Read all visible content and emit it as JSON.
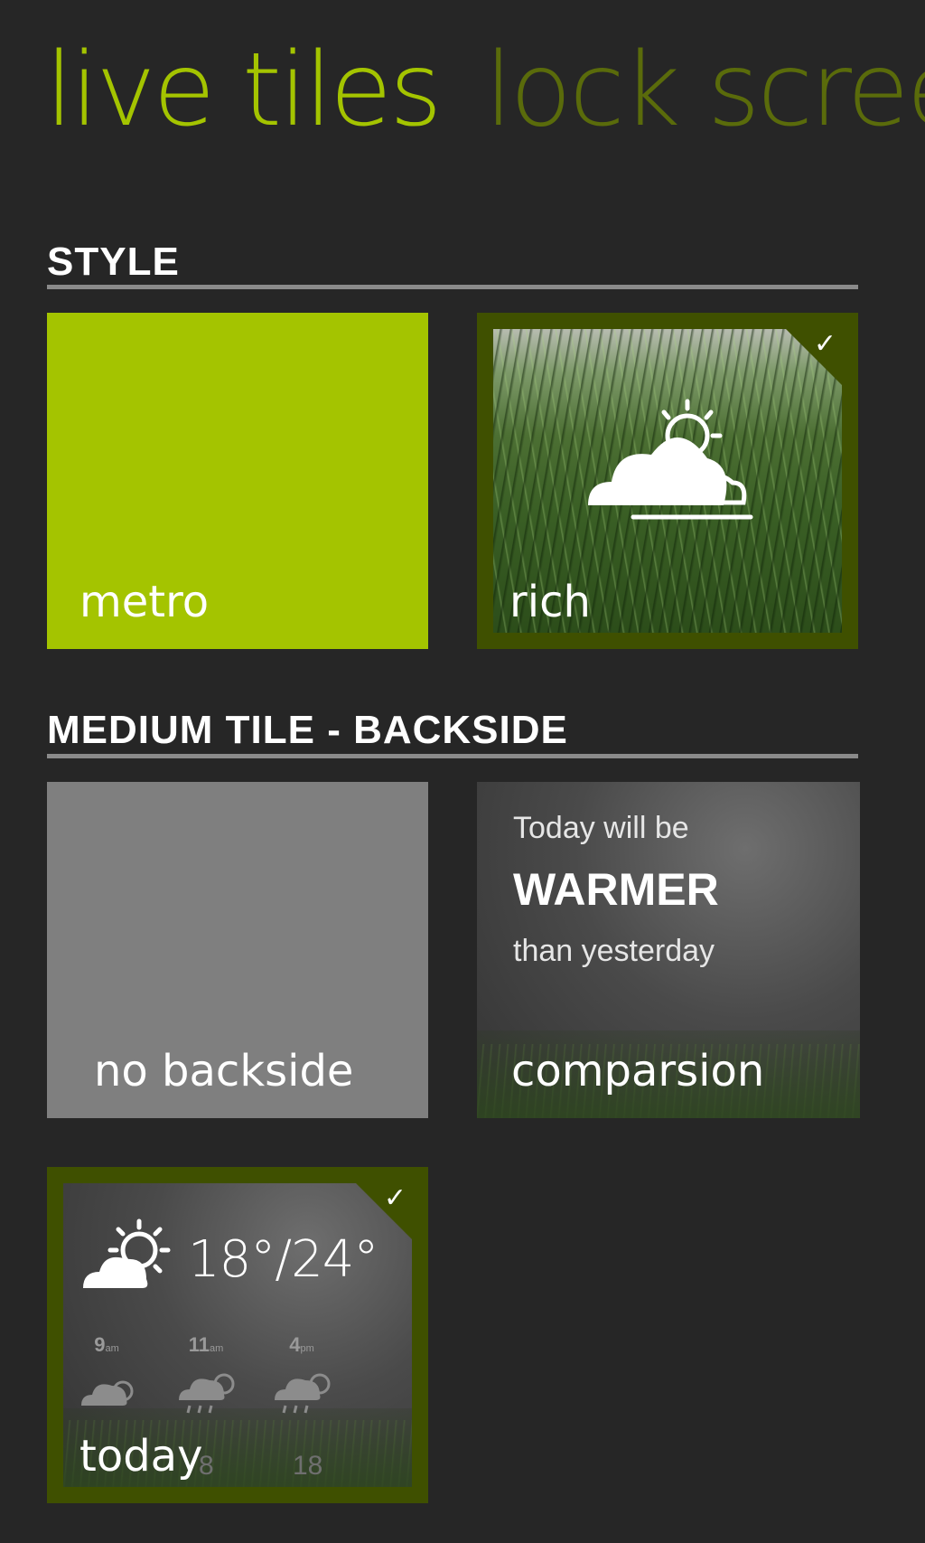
{
  "pivot": {
    "active": "live tiles",
    "inactive": "lock scree"
  },
  "sections": {
    "style": {
      "header": "STYLE",
      "tiles": {
        "metro": {
          "label": "metro",
          "color": "#a4c400",
          "selected": false
        },
        "rich": {
          "label": "rich",
          "selected": true,
          "icon": "partly-cloudy-icon"
        }
      }
    },
    "backside": {
      "header": "MEDIUM TILE - BACKSIDE",
      "tiles": {
        "none": {
          "label": "no backside",
          "color": "#7f7f7f",
          "selected": false
        },
        "comparison": {
          "label": "comparsion",
          "line1": "Today will be",
          "line2": "WARMER",
          "line3": "than yesterday",
          "selected": false
        },
        "today": {
          "label": "today",
          "selected": true,
          "icon": "sun-cloud-icon",
          "temp": "18°/24°",
          "hours": [
            {
              "hour": "9",
              "suffix": "am",
              "icon": "cloud-sun-icon"
            },
            {
              "hour": "11",
              "suffix": "am",
              "icon": "cloud-rain-sun-icon"
            },
            {
              "hour": "4",
              "suffix": "pm",
              "icon": "cloud-rain-sun-icon"
            }
          ],
          "partial_values": [
            "8",
            "18"
          ]
        }
      }
    }
  },
  "colors": {
    "accent": "#a4c400",
    "accent_dim": "#5a6b0b",
    "selection_border": "#3f5000",
    "background": "#262626"
  }
}
